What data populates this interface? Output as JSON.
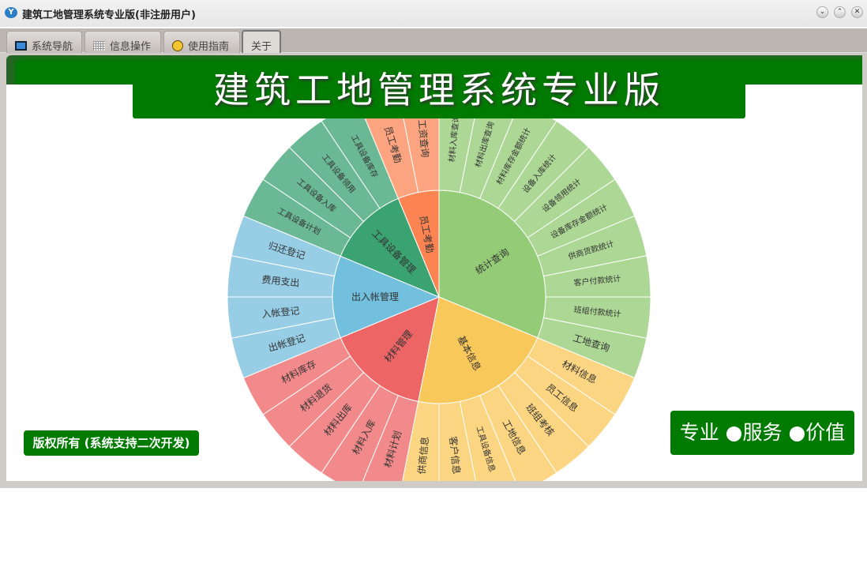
{
  "window": {
    "title": "建筑工地管理系统专业版(非注册用户)",
    "minimize": "⌄",
    "maximize": "⌃",
    "close": "✕"
  },
  "tabs": [
    {
      "label": "系统导航",
      "icon": "monitor-icon"
    },
    {
      "label": "信息操作",
      "icon": "grid-icon"
    },
    {
      "label": "使用指南",
      "icon": "help-icon"
    },
    {
      "label": "关于",
      "active": true
    }
  ],
  "banner": "建筑工地管理系统专业版",
  "copyright": "版权所有 (系统支持二次开发)",
  "slogan": "专业 ●服务 ●价值",
  "chart_data": {
    "type": "sunburst",
    "groups": [
      {
        "name": "统计查询",
        "color": "#93cb76",
        "outer": "#acd795",
        "children": [
          "材料入库查询",
          "材料出库查询",
          "材料库存金额统计",
          "设备入库统计",
          "设备领用统计",
          "设备库存金额统计",
          "供商货款统计",
          "客户付款统计",
          "班组付款统计",
          "工地查询"
        ]
      },
      {
        "name": "基本信息",
        "color": "#f9c85a",
        "outer": "#fbd581",
        "children": [
          "材料信息",
          "员工信息",
          "班组考核",
          "工地信息",
          "工具设备信息",
          "客户信息",
          "供商信息"
        ]
      },
      {
        "name": "材料管理",
        "color": "#ee6566",
        "outer": "#f28a8b",
        "children": [
          "材料计划",
          "材料入库",
          "材料出库",
          "材料退货",
          "材料库存"
        ]
      },
      {
        "name": "出入帐管理",
        "color": "#73bfde",
        "outer": "#97cee6",
        "children": [
          "出帐登记",
          "入帐登记",
          "费用支出",
          "归还登记"
        ]
      },
      {
        "name": "工具设备管理",
        "color": "#3ba272",
        "outer": "#6ab894",
        "children": [
          "工具设备计划",
          "工具设备入库",
          "工具设备领用",
          "工具设备库存"
        ]
      },
      {
        "name": "员工考勤",
        "color": "#fc8452",
        "outer": "#fca47f",
        "children": [
          "员工考勤",
          "工资查询"
        ]
      }
    ]
  }
}
